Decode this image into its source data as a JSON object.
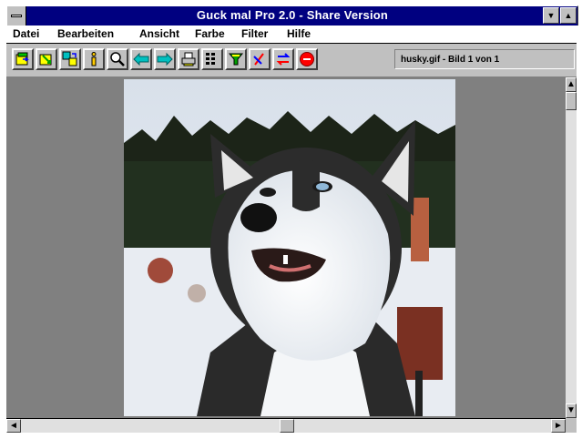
{
  "window": {
    "title": "Guck mal Pro 2.0 - Share Version",
    "minimize_glyph": "▼",
    "maximize_glyph": "▲"
  },
  "menu": {
    "items": [
      "Datei",
      "Bearbeiten",
      "Ansicht",
      "Farbe",
      "Filter",
      "Hilfe"
    ]
  },
  "toolbar": {
    "tools": [
      "open-icon",
      "open-next-icon",
      "convert-icon",
      "info-icon",
      "zoom-icon",
      "previous-icon",
      "next-icon",
      "print-icon",
      "thumbnails-icon",
      "filter-icon",
      "crop-icon",
      "refresh-icon",
      "stop-icon"
    ],
    "status": "husky.gif - Bild 1 von 1"
  },
  "image": {
    "subject": "husky-photo"
  },
  "scrollbars": {
    "left_glyph": "◄",
    "right_glyph": "►",
    "up_glyph": "▲",
    "down_glyph": "▼"
  },
  "colors": {
    "title_bar": "#000080",
    "window_face": "#c0c0c0",
    "client_background": "#808080"
  }
}
